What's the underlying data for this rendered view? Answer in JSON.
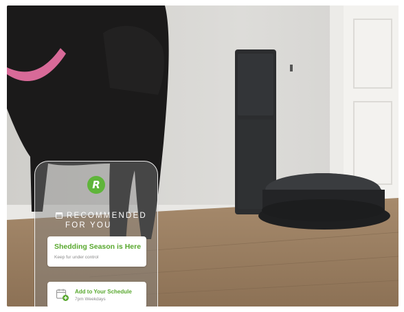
{
  "overlay": {
    "section_heading_line1": "RECOMMENDED",
    "section_heading_line2": "FOR YOU",
    "card_1": {
      "title": "Shedding Season is Here",
      "subtitle": "Keep fur under control"
    },
    "card_2": {
      "title": "Add to Your Schedule",
      "subtitle": "7pm Weekdays"
    }
  },
  "colors": {
    "brand_green": "#58a82e",
    "logo_green": "#5fb53a"
  },
  "icons": [
    "irobot-logo-icon",
    "calendar-icon",
    "calendar-add-icon"
  ]
}
